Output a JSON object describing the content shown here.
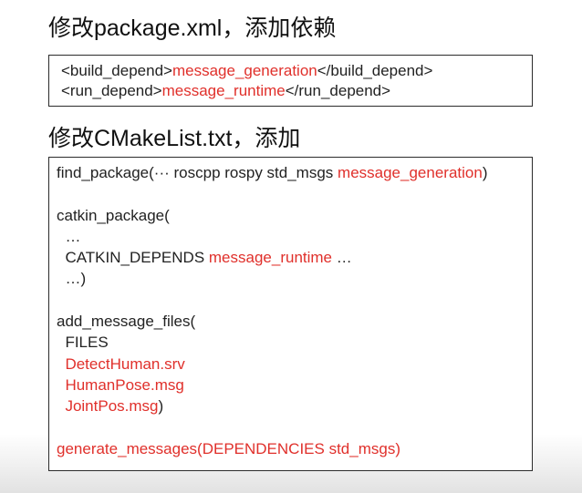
{
  "slide": {
    "heading_1": "修改package.xml，添加依赖",
    "heading_2": "修改CMakeList.txt，添加",
    "accent_color": "#e0302b"
  },
  "package_xml_box": {
    "line_1": {
      "open": "<build_depend>",
      "value": "message_generation",
      "close": "</build_depend>"
    },
    "line_2": {
      "open": "<run_depend>",
      "value": "message_runtime",
      "close": "</run_depend>"
    }
  },
  "cmakelists_box": {
    "find_package": {
      "prefix": "find_package(··· roscpp rospy std_msgs ",
      "value": "message_generation",
      "suffix": ")"
    },
    "catkin_package": {
      "open": "catkin_package(",
      "ellipsis": "  …",
      "depends_prefix": "  CATKIN_DEPENDS ",
      "depends_value": "message_runtime",
      "depends_suffix": " …",
      "close": "  …)"
    },
    "add_message_files": {
      "open": "add_message_files(",
      "files_kw": "  FILES",
      "file_1": "DetectHuman.srv",
      "file_2": "HumanPose.msg",
      "file_3": "JointPos.msg",
      "close": ")"
    },
    "generate_messages": "generate_messages(DEPENDENCIES std_msgs)"
  }
}
